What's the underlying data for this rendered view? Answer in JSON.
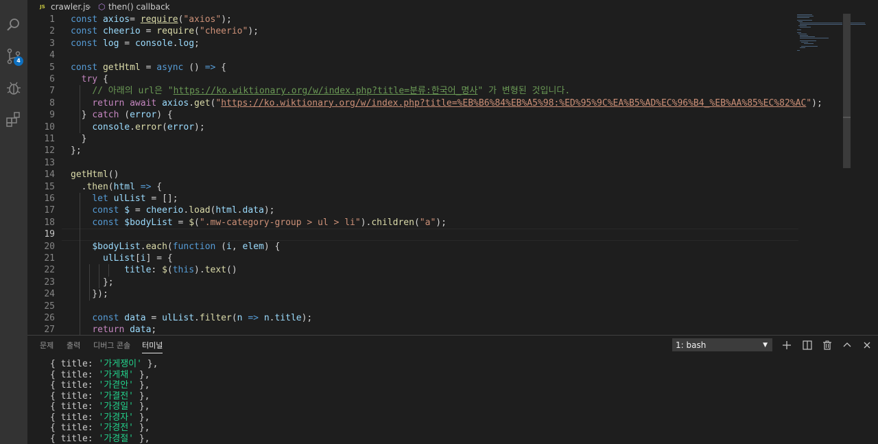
{
  "breadcrumb": {
    "file_icon_text": "JS",
    "file": "crawler.js",
    "symbol": "then() callback"
  },
  "activity_bar": {
    "items": [
      "search-icon",
      "source-control-icon",
      "debug-icon",
      "extensions-icon"
    ],
    "scm_badge": "4"
  },
  "editor": {
    "current_line": "19",
    "line_numbers": [
      "1",
      "2",
      "3",
      "4",
      "5",
      "6",
      "7",
      "8",
      "9",
      "10",
      "11",
      "12",
      "13",
      "14",
      "15",
      "16",
      "17",
      "18",
      "19",
      "20",
      "21",
      "22",
      "23",
      "24",
      "25",
      "26",
      "27"
    ],
    "lines": [
      [
        [
          "kw",
          "const "
        ],
        [
          "var",
          "axios"
        ],
        [
          "",
          "= "
        ],
        [
          "fn ul",
          "require"
        ],
        [
          "",
          "("
        ],
        [
          "str",
          "\"axios\""
        ],
        [
          "",
          ");"
        ]
      ],
      [
        [
          "kw",
          "const "
        ],
        [
          "var",
          "cheerio"
        ],
        [
          "",
          " = "
        ],
        [
          "fn",
          "require"
        ],
        [
          "",
          "("
        ],
        [
          "str",
          "\"cheerio\""
        ],
        [
          "",
          ");"
        ]
      ],
      [
        [
          "kw",
          "const "
        ],
        [
          "var",
          "log"
        ],
        [
          "",
          " = "
        ],
        [
          "var",
          "console"
        ],
        [
          "",
          "."
        ],
        [
          "var",
          "log"
        ],
        [
          "",
          ";"
        ]
      ],
      [],
      [
        [
          "kw",
          "const "
        ],
        [
          "fn",
          "getHtml"
        ],
        [
          "",
          " = "
        ],
        [
          "kw",
          "async"
        ],
        [
          "",
          " () "
        ],
        [
          "kw",
          "=>"
        ],
        [
          "",
          " {"
        ]
      ],
      [
        [
          "",
          "  "
        ],
        [
          "ctl",
          "try"
        ],
        [
          "",
          " {"
        ]
      ],
      [
        [
          "",
          "    "
        ],
        [
          "cm",
          "// 아래의 url은 \""
        ],
        [
          "cm ul",
          "https://ko.wiktionary.org/w/index.php?title=분류:한국어_명사"
        ],
        [
          "cm",
          "\" 가 변형된 것입니다."
        ]
      ],
      [
        [
          "",
          "    "
        ],
        [
          "ctl",
          "return"
        ],
        [
          "",
          " "
        ],
        [
          "ctl",
          "await"
        ],
        [
          "",
          " "
        ],
        [
          "var",
          "axios"
        ],
        [
          "",
          "."
        ],
        [
          "fn",
          "get"
        ],
        [
          "",
          "("
        ],
        [
          "str",
          "\""
        ],
        [
          "str ul",
          "https://ko.wiktionary.org/w/index.php?title=%EB%B6%84%EB%A5%98:%ED%95%9C%EA%B5%AD%EC%96%B4_%EB%AA%85%EC%82%AC"
        ],
        [
          "str",
          "\""
        ],
        [
          "",
          ");"
        ]
      ],
      [
        [
          "",
          "  } "
        ],
        [
          "ctl",
          "catch"
        ],
        [
          "",
          " ("
        ],
        [
          "var",
          "error"
        ],
        [
          "",
          ") {"
        ]
      ],
      [
        [
          "",
          "    "
        ],
        [
          "var",
          "console"
        ],
        [
          "",
          "."
        ],
        [
          "fn",
          "error"
        ],
        [
          "",
          "("
        ],
        [
          "var",
          "error"
        ],
        [
          "",
          ");"
        ]
      ],
      [
        [
          "",
          "  }"
        ]
      ],
      [
        [
          "",
          "};"
        ]
      ],
      [],
      [
        [
          "fn",
          "getHtml"
        ],
        [
          "",
          "()"
        ]
      ],
      [
        [
          "",
          "  ."
        ],
        [
          "fn",
          "then"
        ],
        [
          "",
          "("
        ],
        [
          "var",
          "html"
        ],
        [
          "",
          " "
        ],
        [
          "kw",
          "=>"
        ],
        [
          "",
          " {"
        ]
      ],
      [
        [
          "",
          "    "
        ],
        [
          "kw",
          "let"
        ],
        [
          "",
          " "
        ],
        [
          "var",
          "ulList"
        ],
        [
          "",
          " = [];"
        ]
      ],
      [
        [
          "",
          "    "
        ],
        [
          "kw",
          "const"
        ],
        [
          "",
          " "
        ],
        [
          "var",
          "$"
        ],
        [
          "",
          " = "
        ],
        [
          "var",
          "cheerio"
        ],
        [
          "",
          "."
        ],
        [
          "fn",
          "load"
        ],
        [
          "",
          "("
        ],
        [
          "var",
          "html"
        ],
        [
          "",
          "."
        ],
        [
          "var",
          "data"
        ],
        [
          "",
          ");"
        ]
      ],
      [
        [
          "",
          "    "
        ],
        [
          "kw",
          "const"
        ],
        [
          "",
          " "
        ],
        [
          "var",
          "$bodyList"
        ],
        [
          "",
          " = "
        ],
        [
          "fn",
          "$"
        ],
        [
          "",
          "("
        ],
        [
          "str",
          "\".mw-category-group > ul > li\""
        ],
        [
          "",
          ")."
        ],
        [
          "fn",
          "children"
        ],
        [
          "",
          "("
        ],
        [
          "str",
          "\"a\""
        ],
        [
          "",
          ");"
        ]
      ],
      [],
      [
        [
          "",
          "    "
        ],
        [
          "var",
          "$bodyList"
        ],
        [
          "",
          "."
        ],
        [
          "fn",
          "each"
        ],
        [
          "",
          "("
        ],
        [
          "kw",
          "function"
        ],
        [
          "",
          " ("
        ],
        [
          "var",
          "i"
        ],
        [
          "",
          ", "
        ],
        [
          "var",
          "elem"
        ],
        [
          "",
          ") {"
        ]
      ],
      [
        [
          "",
          "      "
        ],
        [
          "var",
          "ulList"
        ],
        [
          "",
          "["
        ],
        [
          "var",
          "i"
        ],
        [
          "",
          "] = {"
        ]
      ],
      [
        [
          "",
          "          "
        ],
        [
          "var",
          "title"
        ],
        [
          "",
          ": "
        ],
        [
          "fn",
          "$"
        ],
        [
          "",
          "("
        ],
        [
          "kw",
          "this"
        ],
        [
          "",
          ")."
        ],
        [
          "fn",
          "text"
        ],
        [
          "",
          "()"
        ]
      ],
      [
        [
          "",
          "      };"
        ]
      ],
      [
        [
          "",
          "    });"
        ]
      ],
      [],
      [
        [
          "",
          "    "
        ],
        [
          "kw",
          "const"
        ],
        [
          "",
          " "
        ],
        [
          "var",
          "data"
        ],
        [
          "",
          " = "
        ],
        [
          "var",
          "ulList"
        ],
        [
          "",
          "."
        ],
        [
          "fn",
          "filter"
        ],
        [
          "",
          "("
        ],
        [
          "var",
          "n"
        ],
        [
          "",
          " "
        ],
        [
          "kw",
          "=>"
        ],
        [
          "",
          " "
        ],
        [
          "var",
          "n"
        ],
        [
          "",
          "."
        ],
        [
          "var",
          "title"
        ],
        [
          "",
          ");"
        ]
      ],
      [
        [
          "",
          "    "
        ],
        [
          "ctl",
          "return"
        ],
        [
          "",
          " "
        ],
        [
          "var",
          "data"
        ],
        [
          "",
          ";"
        ]
      ]
    ]
  },
  "panel": {
    "tabs": [
      "문제",
      "출력",
      "디버그 콘솔",
      "터미널"
    ],
    "active_tab": "터미널",
    "terminal_select": "1: bash",
    "terminal_lines": [
      [
        "{ title: ",
        "'가게쟁이'",
        " },"
      ],
      [
        "{ title: ",
        "'가게채'",
        " },"
      ],
      [
        "{ title: ",
        "'가겯안'",
        " },"
      ],
      [
        "{ title: ",
        "'가결전'",
        " },"
      ],
      [
        "{ title: ",
        "'가경일'",
        " },"
      ],
      [
        "{ title: ",
        "'가경자'",
        " },"
      ],
      [
        "{ title: ",
        "'가경전'",
        " },"
      ],
      [
        "{ title: ",
        "'가경절'",
        " },"
      ]
    ]
  },
  "colors": {
    "background": "#1e1e1e",
    "activity_bar": "#333333",
    "badge": "#0e70c0",
    "terminal_string": "#23d18b"
  }
}
